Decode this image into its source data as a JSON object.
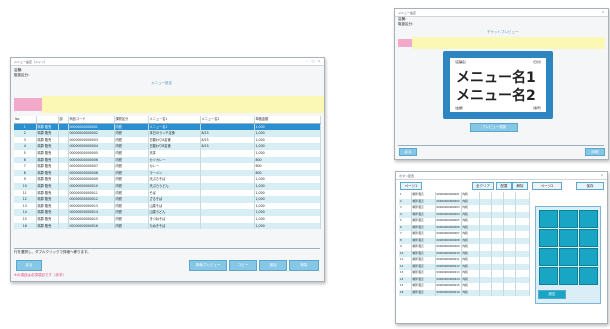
{
  "main_window": {
    "title": "メニュー設定（メイン）",
    "header_left": [
      "店舗：",
      "取扱区分："
    ],
    "center_title": "メニュー設定",
    "columns": [
      "No.",
      "",
      "部",
      "商品コード",
      "課税区分",
      "メニュー名1",
      "メニュー名2",
      "単価金額"
    ],
    "rows": [
      {
        "no": "1",
        "c1": "精算 販売",
        "c2": "",
        "code": "00000000000001",
        "tax": "内税",
        "name1": "メニュー名1",
        "name2": "",
        "price": "1,000"
      },
      {
        "no": "2",
        "c1": "精算 販売",
        "c2": "",
        "code": "00000000000002",
        "tax": "内税",
        "name1": "本日のランチ定食",
        "name2": "8/15",
        "price": "1,000"
      },
      {
        "no": "3",
        "c1": "精算 販売",
        "c2": "",
        "code": "00000000000003",
        "tax": "内税",
        "name1": "日替わりA定食",
        "name2": "8/15",
        "price": "1,000"
      },
      {
        "no": "4",
        "c1": "精算 販売",
        "c2": "",
        "code": "00000000000004",
        "tax": "内税",
        "name1": "日替わりB定食",
        "name2": "8/15",
        "price": "1,000"
      },
      {
        "no": "5",
        "c1": "精算 販売",
        "c2": "",
        "code": "00000000000005",
        "tax": "内税",
        "name1": "天丼",
        "name2": "",
        "price": "1,000"
      },
      {
        "no": "6",
        "c1": "精算 販売",
        "c2": "",
        "code": "00000000000006",
        "tax": "内税",
        "name1": "カツカレー",
        "name2": "",
        "price": "800"
      },
      {
        "no": "7",
        "c1": "精算 販売",
        "c2": "",
        "code": "00000000000007",
        "tax": "内税",
        "name1": "カレー",
        "name2": "",
        "price": "600"
      },
      {
        "no": "8",
        "c1": "精算 販売",
        "c2": "",
        "code": "00000000000008",
        "tax": "内税",
        "name1": "ラーメン",
        "name2": "",
        "price": "600"
      },
      {
        "no": "9",
        "c1": "精算 販売",
        "c2": "",
        "code": "00000000000009",
        "tax": "内税",
        "name1": "天ぷらそば",
        "name2": "",
        "price": "1,000"
      },
      {
        "no": "10",
        "c1": "精算 販売",
        "c2": "",
        "code": "00000000000010",
        "tax": "内税",
        "name1": "天ぷらうどん",
        "name2": "",
        "price": "1,000"
      },
      {
        "no": "11",
        "c1": "精算 販売",
        "c2": "",
        "code": "00000000000011",
        "tax": "内税",
        "name1": "そば",
        "name2": "",
        "price": "1,000"
      },
      {
        "no": "12",
        "c1": "精算 販売",
        "c2": "",
        "code": "00000000000012",
        "tax": "内税",
        "name1": "ざるそば",
        "name2": "",
        "price": "1,000"
      },
      {
        "no": "13",
        "c1": "精算 販売",
        "c2": "",
        "code": "00000000000013",
        "tax": "内税",
        "name1": "山菜そば",
        "name2": "",
        "price": "1,000"
      },
      {
        "no": "14",
        "c1": "精算 販売",
        "c2": "",
        "code": "00000000000014",
        "tax": "内税",
        "name1": "山菜うどん",
        "name2": "",
        "price": "1,000"
      },
      {
        "no": "15",
        "c1": "精算 販売",
        "c2": "",
        "code": "00000000000015",
        "tax": "内税",
        "name1": "きつねそば",
        "name2": "",
        "price": "1,000"
      },
      {
        "no": "16",
        "c1": "精算 販売",
        "c2": "",
        "code": "00000000000016",
        "tax": "内税",
        "name1": "たぬきそば",
        "name2": "",
        "price": "1,000"
      }
    ],
    "hint": "行を選択し、ダブルクリックで詳細へ移ります。",
    "footer_left_button": "戻る",
    "footer_note": "※の項目は必須項目です（赤字）",
    "buttons": [
      "券面プレビュー",
      "コピー",
      "追加",
      "削除"
    ]
  },
  "preview_window": {
    "title": "メニュー設定",
    "header_left": [
      "店舗：",
      "取扱区分："
    ],
    "top_label": "チケットプレビュー",
    "ticket_header_left": "（店舗名）",
    "ticket_header_right": "（日付）",
    "ticket_line1": "メニュー名1",
    "ticket_line2": "メニュー名2",
    "ticket_footer_left": "（金額）",
    "ticket_footer_right": "（番号）",
    "action_button": "プレビュー更新",
    "left_button": "戻る",
    "right_button": "印刷"
  },
  "grid_window": {
    "title": "ボタン配置",
    "tabs": [
      "ページ1",
      "ページ2",
      "ページ3"
    ],
    "toolbar": [
      "全クリア",
      "配置",
      "解除"
    ],
    "right_button": "保存",
    "rows_count_label": "登録数",
    "button_label": "設定"
  },
  "colors": {
    "selection": "#2a8fd0",
    "row_alt": "#d6eef4",
    "pink": "#f3a9c9",
    "yellow": "#fbf7b5",
    "tile": "#18a6c4",
    "button": "#86c7e6"
  }
}
